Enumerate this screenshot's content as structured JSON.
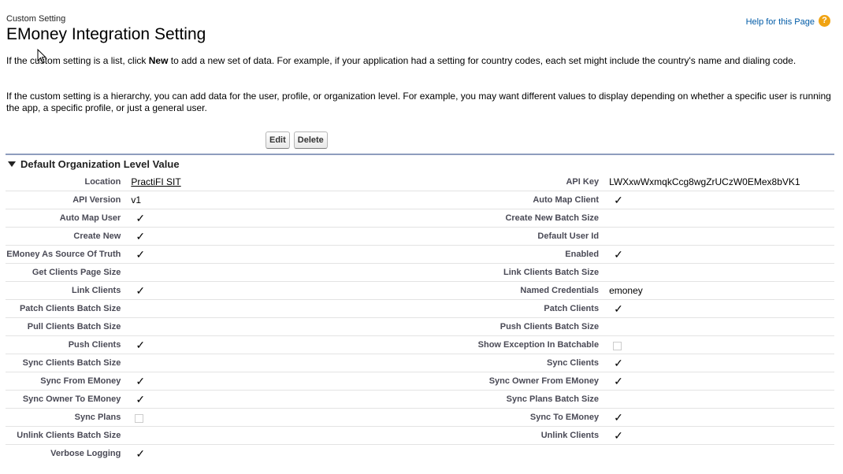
{
  "header": {
    "subtitle": "Custom Setting",
    "title": "EMoney Integration Setting",
    "help_label": "Help for this Page",
    "help_icon": "?"
  },
  "description": {
    "p1_pre": "If the custom setting is a list, click ",
    "p1_bold": "New",
    "p1_post": " to add a new set of data. For example, if your application had a setting for country codes, each set might include the country's name and dialing code.",
    "p2": "If the custom setting is a hierarchy, you can add data for the user, profile, or organization level. For example, you may want different values to display depending on whether a specific user is running the app, a specific profile, or just a general user."
  },
  "buttons": {
    "edit": "Edit",
    "delete": "Delete"
  },
  "section": {
    "title": "Default Organization Level Value"
  },
  "check_glyph": "✓",
  "rows": [
    {
      "l_label": "Location",
      "l_value": "PractiFI SIT",
      "l_type": "link",
      "r_label": "API Key",
      "r_value": "LWXxwWxmqkCcg8wgZrUCzW0EMex8bVK1",
      "r_type": "text"
    },
    {
      "l_label": "API Version",
      "l_value": "v1",
      "l_type": "text",
      "r_label": "Auto Map Client",
      "r_value": "",
      "r_type": "check"
    },
    {
      "l_label": "Auto Map User",
      "l_value": "",
      "l_type": "check",
      "r_label": "Create New Batch Size",
      "r_value": "",
      "r_type": "empty"
    },
    {
      "l_label": "Create New",
      "l_value": "",
      "l_type": "check",
      "r_label": "Default User Id",
      "r_value": "",
      "r_type": "empty"
    },
    {
      "l_label": "EMoney As Source Of Truth",
      "l_value": "",
      "l_type": "check",
      "r_label": "Enabled",
      "r_value": "",
      "r_type": "check"
    },
    {
      "l_label": "Get Clients Page Size",
      "l_value": "",
      "l_type": "empty",
      "r_label": "Link Clients Batch Size",
      "r_value": "",
      "r_type": "empty"
    },
    {
      "l_label": "Link Clients",
      "l_value": "",
      "l_type": "check",
      "r_label": "Named Credentials",
      "r_value": "emoney",
      "r_type": "text"
    },
    {
      "l_label": "Patch Clients Batch Size",
      "l_value": "",
      "l_type": "empty",
      "r_label": "Patch Clients",
      "r_value": "",
      "r_type": "check"
    },
    {
      "l_label": "Pull Clients Batch Size",
      "l_value": "",
      "l_type": "empty",
      "r_label": "Push Clients Batch Size",
      "r_value": "",
      "r_type": "empty"
    },
    {
      "l_label": "Push Clients",
      "l_value": "",
      "l_type": "check",
      "r_label": "Show Exception In Batchable",
      "r_value": "",
      "r_type": "uncheck"
    },
    {
      "l_label": "Sync Clients Batch Size",
      "l_value": "",
      "l_type": "empty",
      "r_label": "Sync Clients",
      "r_value": "",
      "r_type": "check"
    },
    {
      "l_label": "Sync From EMoney",
      "l_value": "",
      "l_type": "check",
      "r_label": "Sync Owner From EMoney",
      "r_value": "",
      "r_type": "check"
    },
    {
      "l_label": "Sync Owner To EMoney",
      "l_value": "",
      "l_type": "check",
      "r_label": "Sync Plans Batch Size",
      "r_value": "",
      "r_type": "empty"
    },
    {
      "l_label": "Sync Plans",
      "l_value": "",
      "l_type": "uncheck",
      "r_label": "Sync To EMoney",
      "r_value": "",
      "r_type": "check"
    },
    {
      "l_label": "Unlink Clients Batch Size",
      "l_value": "",
      "l_type": "empty",
      "r_label": "Unlink Clients",
      "r_value": "",
      "r_type": "check"
    },
    {
      "l_label": "Verbose Logging",
      "l_value": "",
      "l_type": "check",
      "r_label": "",
      "r_value": "",
      "r_type": "empty"
    }
  ]
}
